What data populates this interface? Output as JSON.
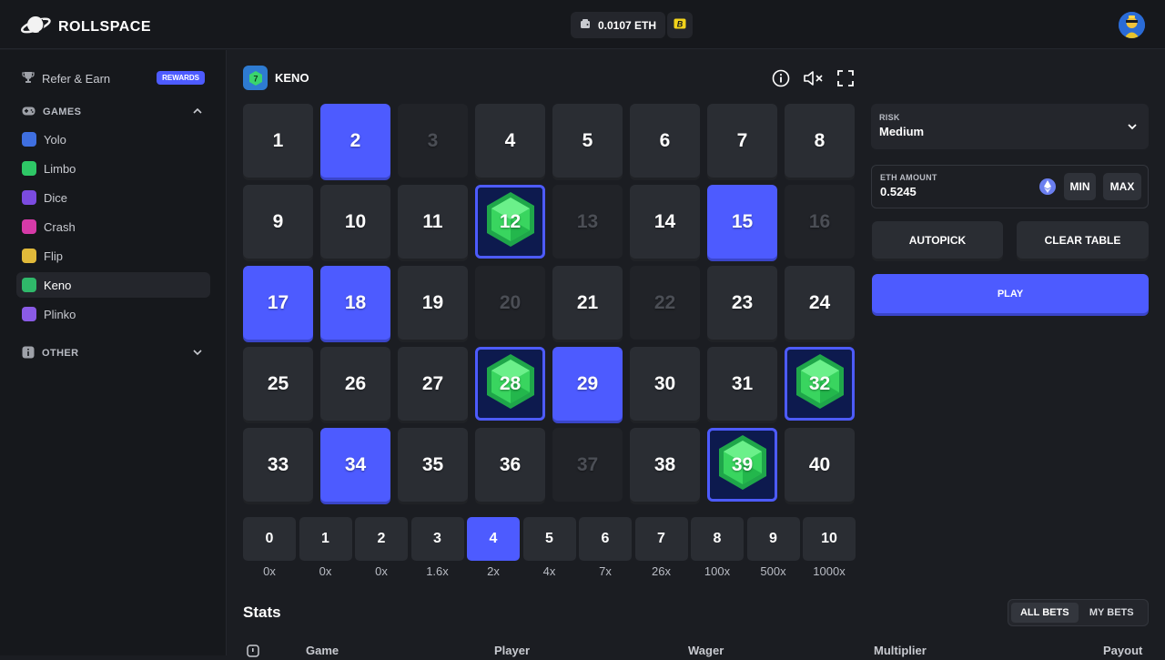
{
  "brand": {
    "name": "ROLLSPACE"
  },
  "header": {
    "balance": "0.0107 ETH",
    "token_icon": "b-token-icon",
    "accent": "#f2d31b"
  },
  "sidebar": {
    "refer": {
      "label": "Refer & Earn",
      "badge": "REWARDS"
    },
    "games_header": "GAMES",
    "games": [
      {
        "label": "Yolo",
        "color": "#3f6fe0"
      },
      {
        "label": "Limbo",
        "color": "#2ec766"
      },
      {
        "label": "Dice",
        "color": "#7b4be0"
      },
      {
        "label": "Crash",
        "color": "#d63aa8"
      },
      {
        "label": "Flip",
        "color": "#e0b93a"
      },
      {
        "label": "Keno",
        "color": "#2fb86a"
      },
      {
        "label": "Plinko",
        "color": "#8a5be6"
      }
    ],
    "other_header": "OTHER"
  },
  "game": {
    "title": "KENO",
    "tiles": [
      {
        "n": "1",
        "s": "normal"
      },
      {
        "n": "2",
        "s": "sel"
      },
      {
        "n": "3",
        "s": "dim"
      },
      {
        "n": "4",
        "s": "normal"
      },
      {
        "n": "5",
        "s": "normal"
      },
      {
        "n": "6",
        "s": "normal"
      },
      {
        "n": "7",
        "s": "normal"
      },
      {
        "n": "8",
        "s": "normal"
      },
      {
        "n": "9",
        "s": "normal"
      },
      {
        "n": "10",
        "s": "normal"
      },
      {
        "n": "11",
        "s": "normal"
      },
      {
        "n": "12",
        "s": "hit"
      },
      {
        "n": "13",
        "s": "dim"
      },
      {
        "n": "14",
        "s": "normal"
      },
      {
        "n": "15",
        "s": "sel"
      },
      {
        "n": "16",
        "s": "dim"
      },
      {
        "n": "17",
        "s": "sel"
      },
      {
        "n": "18",
        "s": "sel"
      },
      {
        "n": "19",
        "s": "normal"
      },
      {
        "n": "20",
        "s": "dim"
      },
      {
        "n": "21",
        "s": "normal"
      },
      {
        "n": "22",
        "s": "dim"
      },
      {
        "n": "23",
        "s": "normal"
      },
      {
        "n": "24",
        "s": "normal"
      },
      {
        "n": "25",
        "s": "normal"
      },
      {
        "n": "26",
        "s": "normal"
      },
      {
        "n": "27",
        "s": "normal"
      },
      {
        "n": "28",
        "s": "hit"
      },
      {
        "n": "29",
        "s": "sel"
      },
      {
        "n": "30",
        "s": "normal"
      },
      {
        "n": "31",
        "s": "normal"
      },
      {
        "n": "32",
        "s": "hit"
      },
      {
        "n": "33",
        "s": "normal"
      },
      {
        "n": "34",
        "s": "sel"
      },
      {
        "n": "35",
        "s": "normal"
      },
      {
        "n": "36",
        "s": "normal"
      },
      {
        "n": "37",
        "s": "dim"
      },
      {
        "n": "38",
        "s": "normal"
      },
      {
        "n": "39",
        "s": "hit"
      },
      {
        "n": "40",
        "s": "normal"
      }
    ],
    "payouts": [
      {
        "hits": "0",
        "mult": "0x"
      },
      {
        "hits": "1",
        "mult": "0x"
      },
      {
        "hits": "2",
        "mult": "0x"
      },
      {
        "hits": "3",
        "mult": "1.6x"
      },
      {
        "hits": "4",
        "mult": "2x",
        "active": true
      },
      {
        "hits": "5",
        "mult": "4x"
      },
      {
        "hits": "6",
        "mult": "7x"
      },
      {
        "hits": "7",
        "mult": "26x"
      },
      {
        "hits": "8",
        "mult": "100x"
      },
      {
        "hits": "9",
        "mult": "500x"
      },
      {
        "hits": "10",
        "mult": "1000x"
      }
    ]
  },
  "controls": {
    "risk_label": "RISK",
    "risk_value": "Medium",
    "amount_label": "ETH AMOUNT",
    "amount_value": "0.5245",
    "min": "MIN",
    "max": "MAX",
    "autopick": "AUTOPICK",
    "clear": "CLEAR TABLE",
    "play": "PLAY"
  },
  "stats": {
    "title": "Stats",
    "tabs": [
      "ALL BETS",
      "MY BETS"
    ],
    "columns": [
      "Game",
      "Player",
      "Wager",
      "Multiplier",
      "Payout"
    ]
  }
}
